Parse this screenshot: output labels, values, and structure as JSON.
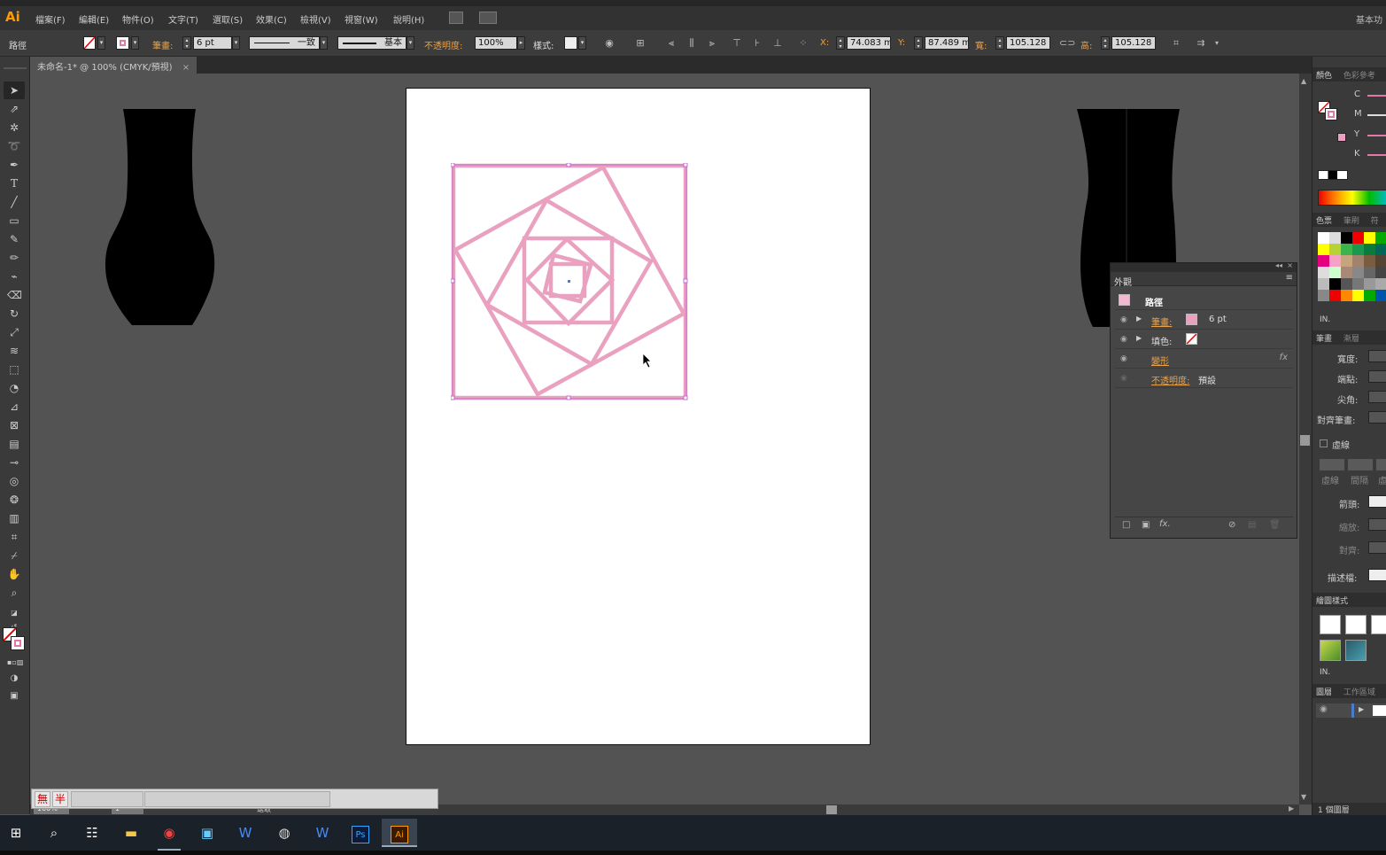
{
  "app": {
    "logo": "Ai",
    "workspace": "基本功"
  },
  "menu": [
    "檔案(F)",
    "編輯(E)",
    "物件(O)",
    "文字(T)",
    "選取(S)",
    "效果(C)",
    "檢視(V)",
    "視窗(W)",
    "說明(H)"
  ],
  "control": {
    "object_type": "路徑",
    "stroke_label": "筆畫:",
    "stroke_weight": "6 pt",
    "profile": "一致",
    "brush": "基本",
    "opacity_label": "不透明度:",
    "opacity": "100%",
    "style_label": "樣式:",
    "x_label": "X:",
    "x_value": "74.083 m",
    "y_label": "Y:",
    "y_value": "87.489 m",
    "w_label": "寬:",
    "w_value": "105.128",
    "h_label": "高:",
    "h_value": "105.128"
  },
  "document": {
    "tab_title": "未命名-1* @ 100% (CMYK/預視)",
    "close": "×"
  },
  "status": {
    "zoom": "100%",
    "page": "1",
    "tool": "選取"
  },
  "ime": {
    "k1": "無",
    "k2": "半"
  },
  "appearance": {
    "title": "外觀",
    "object": "路徑",
    "stroke_label": "筆畫:",
    "stroke_value": "6 pt",
    "fill_label": "填色:",
    "transform": "變形",
    "opacity_label": "不透明度:",
    "opacity_value": "預設",
    "fx": "fx"
  },
  "panels": {
    "color": {
      "tab1": "顏色",
      "tab2": "色彩參考",
      "c": "C",
      "m": "M",
      "y": "Y",
      "k": "K"
    },
    "swatches": {
      "tab1": "色票",
      "tab2": "筆刷",
      "tab3": "符"
    },
    "stroke": {
      "tab1": "筆畫",
      "tab2": "漸層",
      "weight": "寬度:",
      "cap": "端點:",
      "corner": "尖角:",
      "align": "對齊筆畫:",
      "dashed": "虛線",
      "dash": "虛線",
      "gap": "間隔",
      "dash3": "虛",
      "arrow": "箭頭:",
      "scale": "縮放:",
      "align2": "對齊:",
      "profile": "描述檔:"
    },
    "graphic_styles": {
      "tab": "繪圖樣式"
    },
    "layers": {
      "tab1": "圖層",
      "tab2": "工作區域",
      "count": "1 個圖層"
    },
    "menu_glyph": "IN."
  },
  "colors": {
    "stroke_pink": "#eaa1c0",
    "selection": "#c56cd0",
    "accent_orange": "#e8a04a"
  },
  "icons": {
    "selection": "selection-tool-icon",
    "direct": "direct-selection-icon",
    "eye": "visibility-eye-icon"
  },
  "taskbar": [
    "start-icon",
    "search-icon",
    "task-view-icon",
    "file-explorer-icon",
    "chrome-icon",
    "app-icon",
    "word-icon",
    "obs-icon",
    "word-icon-2",
    "photoshop-icon",
    "illustrator-icon"
  ]
}
